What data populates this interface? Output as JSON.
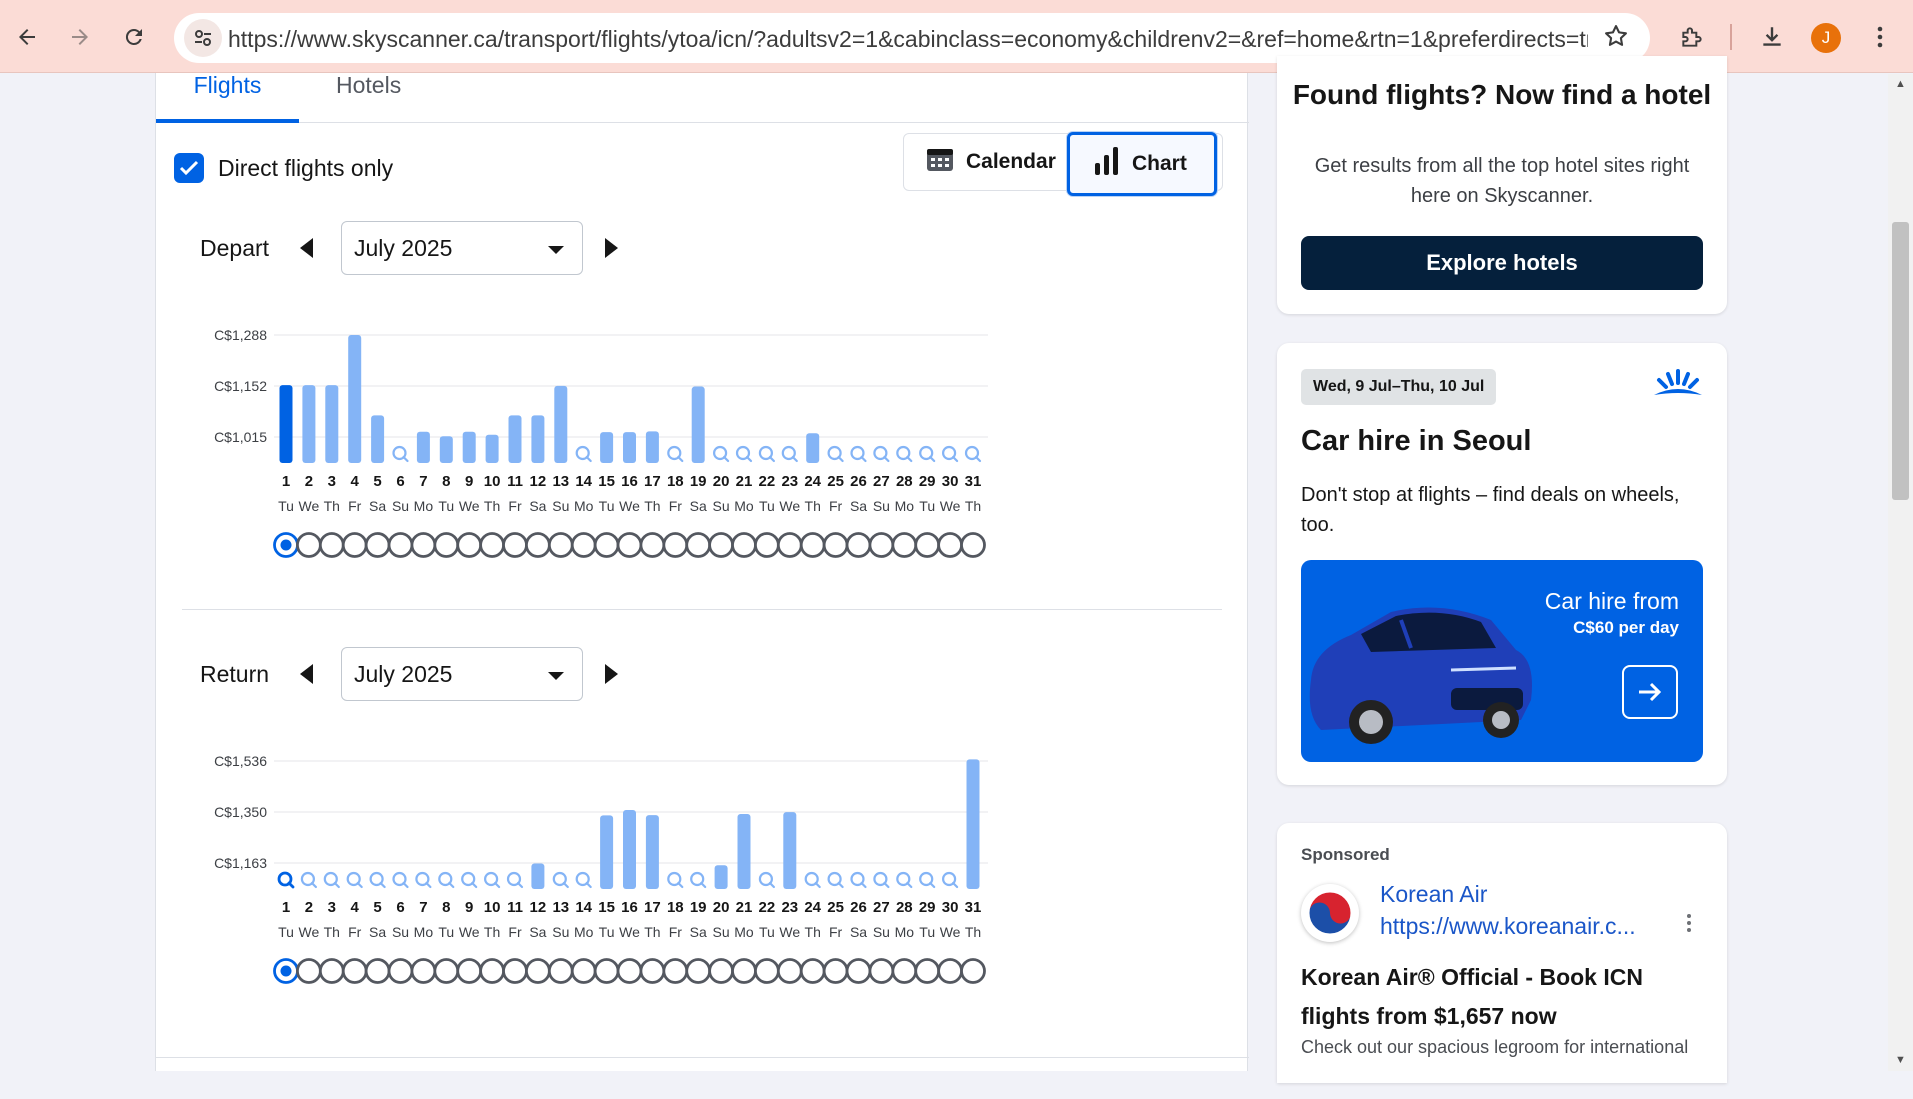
{
  "browser": {
    "url": "https://www.skyscanner.ca/transport/flights/ytoa/icn/?adultsv2=1&cabinclass=economy&childrenv2=&ref=home&rtn=1&preferdirects=true&o...",
    "profile_initial": "J"
  },
  "tabs": {
    "flights": "Flights",
    "hotels": "Hotels"
  },
  "filters": {
    "direct_label": "Direct flights only",
    "direct_checked": true
  },
  "view_toggle": {
    "calendar_label": "Calendar",
    "chart_label": "Chart",
    "selected": "Chart"
  },
  "depart": {
    "label": "Depart",
    "month": "July 2025"
  },
  "return": {
    "label": "Return",
    "month": "July 2025"
  },
  "colors": {
    "accent": "#0062e3",
    "bar": "#84b4f6",
    "bar_selected": "#0062e3",
    "dark_button": "#05203c"
  },
  "chart_data": [
    {
      "type": "bar",
      "title": "",
      "yticks": [
        "C$1,288",
        "C$1,152",
        "C$1,015"
      ],
      "ytick_values": [
        1288,
        1152,
        1015
      ],
      "categories": [
        "1",
        "2",
        "3",
        "4",
        "5",
        "6",
        "7",
        "8",
        "9",
        "10",
        "11",
        "12",
        "13",
        "14",
        "15",
        "16",
        "17",
        "18",
        "19",
        "20",
        "21",
        "22",
        "23",
        "24",
        "25",
        "26",
        "27",
        "28",
        "29",
        "30",
        "31"
      ],
      "weekdays": [
        "Tu",
        "We",
        "Th",
        "Fr",
        "Sa",
        "Su",
        "Mo",
        "Tu",
        "We",
        "Th",
        "Fr",
        "Sa",
        "Su",
        "Mo",
        "Tu",
        "We",
        "Th",
        "Fr",
        "Sa",
        "Su",
        "Mo",
        "Tu",
        "We",
        "Th",
        "Fr",
        "Sa",
        "Su",
        "Mo",
        "Tu",
        "We",
        "Th"
      ],
      "values": [
        1154,
        1154,
        1154,
        1288,
        1073,
        null,
        1029,
        1017,
        1029,
        1021,
        1073,
        1073,
        1152,
        null,
        1028,
        1028,
        1030,
        null,
        1150,
        null,
        null,
        null,
        null,
        1025,
        null,
        null,
        null,
        null,
        null,
        null,
        null
      ],
      "selected_day": "1",
      "grid": true
    },
    {
      "type": "bar",
      "title": "",
      "yticks": [
        "C$1,536",
        "C$1,350",
        "C$1,163"
      ],
      "ytick_values": [
        1536,
        1350,
        1163
      ],
      "categories": [
        "1",
        "2",
        "3",
        "4",
        "5",
        "6",
        "7",
        "8",
        "9",
        "10",
        "11",
        "12",
        "13",
        "14",
        "15",
        "16",
        "17",
        "18",
        "19",
        "20",
        "21",
        "22",
        "23",
        "24",
        "25",
        "26",
        "27",
        "28",
        "29",
        "30",
        "31"
      ],
      "weekdays": [
        "Tu",
        "We",
        "Th",
        "Fr",
        "Sa",
        "Su",
        "Mo",
        "Tu",
        "We",
        "Th",
        "Fr",
        "Sa",
        "Su",
        "Mo",
        "Tu",
        "We",
        "Th",
        "Fr",
        "Sa",
        "Su",
        "Mo",
        "Tu",
        "We",
        "Th",
        "Fr",
        "Sa",
        "Su",
        "Mo",
        "Tu",
        "We",
        "Th"
      ],
      "values": [
        null,
        null,
        null,
        null,
        null,
        null,
        null,
        null,
        null,
        null,
        null,
        1161,
        null,
        null,
        1337,
        1357,
        1338,
        null,
        null,
        1155,
        1342,
        null,
        1349,
        null,
        null,
        null,
        null,
        null,
        null,
        null,
        1542
      ],
      "selected_day": "1",
      "grid": true
    }
  ],
  "hotel_promo": {
    "title": "Found flights? Now find a hotel",
    "desc": "Get results from all the top hotel sites right here on Skyscanner.",
    "button": "Explore hotels"
  },
  "car_promo": {
    "dates": "Wed, 9 Jul–Thu, 10 Jul",
    "title": "Car hire in Seoul",
    "desc": "Don't stop at flights – find deals on wheels, too.",
    "banner_from": "Car hire from",
    "banner_price": "C$60 per day"
  },
  "ad": {
    "sponsored": "Sponsored",
    "name": "Korean Air",
    "url": "https://www.koreanair.c...",
    "headline": "Korean Air® Official - Book ICN flights from $1,657 now",
    "body": "Check out our spacious legroom for international"
  }
}
